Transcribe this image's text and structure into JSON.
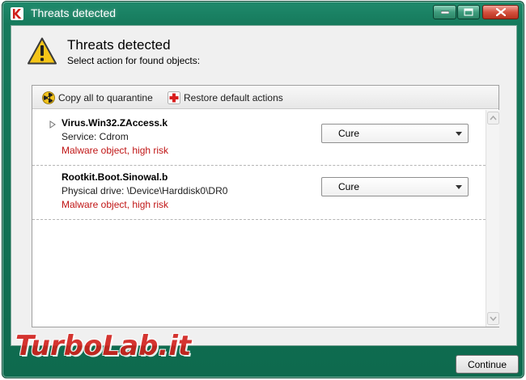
{
  "window": {
    "title": "Threats detected"
  },
  "header": {
    "title": "Threats detected",
    "subtitle": "Select action for found objects:"
  },
  "toolbar": {
    "copy_label": "Copy all to quarantine",
    "restore_label": "Restore default actions"
  },
  "threats": [
    {
      "name": "Virus.Win32.ZAccess.k",
      "detail": "Service: Cdrom",
      "risk": "Malware object, high risk",
      "action": "Cure"
    },
    {
      "name": "Rootkit.Boot.Sinowal.b",
      "detail": "Physical drive: \\Device\\Harddisk0\\DR0",
      "risk": "Malware object, high risk",
      "action": "Cure"
    }
  ],
  "footer": {
    "continue_label": "Continue"
  },
  "watermark": {
    "text": "TurboLab.it"
  },
  "colors": {
    "window_frame": "#167a5c",
    "risk_text": "#c01515",
    "close_button": "#d5523f"
  },
  "icons": {
    "app": "kaspersky-k-icon",
    "warning": "warning-triangle-icon",
    "quarantine": "radiation-icon",
    "restore": "red-cross-icon"
  }
}
